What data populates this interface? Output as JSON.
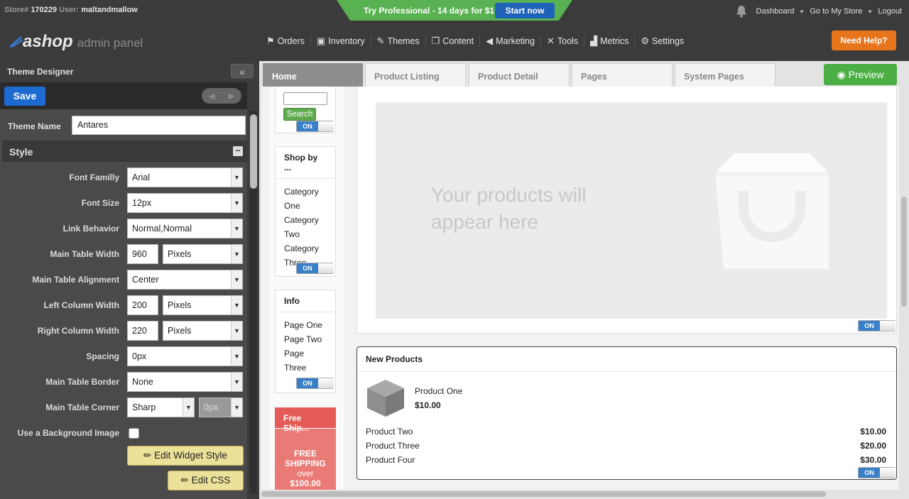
{
  "topbar": {
    "store_label": "Store#",
    "store_number": "170229",
    "user_label": "User:",
    "user_name": "maltandmallow",
    "promo_text": "Try Professional - 14 days for $1",
    "promo_button": "Start now",
    "links": [
      "Dashboard",
      "Go to My Store",
      "Logout"
    ]
  },
  "header": {
    "logo_main": "ashop",
    "logo_sub": "admin panel",
    "nav": [
      {
        "label": "Orders",
        "icon": "orders-icon"
      },
      {
        "label": "Inventory",
        "icon": "inventory-icon"
      },
      {
        "label": "Themes",
        "icon": "themes-icon"
      },
      {
        "label": "Content",
        "icon": "content-icon"
      },
      {
        "label": "Marketing",
        "icon": "marketing-icon"
      },
      {
        "label": "Tools",
        "icon": "tools-icon"
      },
      {
        "label": "Metrics",
        "icon": "metrics-icon"
      },
      {
        "label": "Settings",
        "icon": "settings-icon"
      }
    ],
    "help_button": "Need Help?"
  },
  "sidebar": {
    "title": "Theme Designer",
    "save": "Save",
    "theme_name_label": "Theme Name",
    "theme_name_value": "Antares",
    "section_title": "Style",
    "fields": {
      "font_family": {
        "label": "Font Familly",
        "value": "Arial"
      },
      "font_size": {
        "label": "Font Size",
        "value": "12px"
      },
      "link_behavior": {
        "label": "Link Behavior",
        "value": "Normal,Normal"
      },
      "main_table_width": {
        "label": "Main Table Width",
        "value": "960",
        "unit": "Pixels"
      },
      "main_table_alignment": {
        "label": "Main Table Alignment",
        "value": "Center"
      },
      "left_column_width": {
        "label": "Left Column Width",
        "value": "200",
        "unit": "Pixels"
      },
      "right_column_width": {
        "label": "Right Column Width",
        "value": "220",
        "unit": "Pixels"
      },
      "spacing": {
        "label": "Spacing",
        "value": "0px"
      },
      "main_table_border": {
        "label": "Main Table Border",
        "value": "None"
      },
      "main_table_corner": {
        "label": "Main Table Corner",
        "value": "Sharp",
        "radius": "0px"
      },
      "background_image": {
        "label": "Use a Background Image",
        "checked": false
      }
    },
    "edit_widget_style": "Edit Widget Style",
    "edit_css": "Edit CSS"
  },
  "designer": {
    "tabs": [
      "Home",
      "Product Listing",
      "Product Detail",
      "Pages",
      "System Pages"
    ],
    "active_tab": "Home",
    "preview": "Preview",
    "search_button": "Search",
    "toggle_on": "ON",
    "shop_by": {
      "title": "Shop by ...",
      "items": [
        "Category",
        "One",
        "Category",
        "Two",
        "Category",
        "Three"
      ]
    },
    "info": {
      "title": "Info",
      "items": [
        "Page One",
        "Page Two",
        "Page",
        "Three"
      ]
    },
    "free_ship": {
      "title": "Free Ship...",
      "line1": "FREE",
      "line2": "SHIPPING",
      "line3": "over",
      "line4": "$100.00"
    },
    "placeholder_text": "Your products will appear here",
    "new_products": {
      "title": "New Products",
      "featured": {
        "name": "Product One",
        "price": "$10.00"
      },
      "list": [
        {
          "name": "Product Two",
          "price": "$10.00"
        },
        {
          "name": "Product Three",
          "price": "$20.00"
        },
        {
          "name": "Product Four",
          "price": "$30.00"
        }
      ]
    }
  },
  "colors": {
    "save": "#1d6ad0",
    "help": "#e8741c",
    "promo": "#59b252",
    "preview": "#4caf45",
    "toggle_on": "#3a80c9"
  }
}
